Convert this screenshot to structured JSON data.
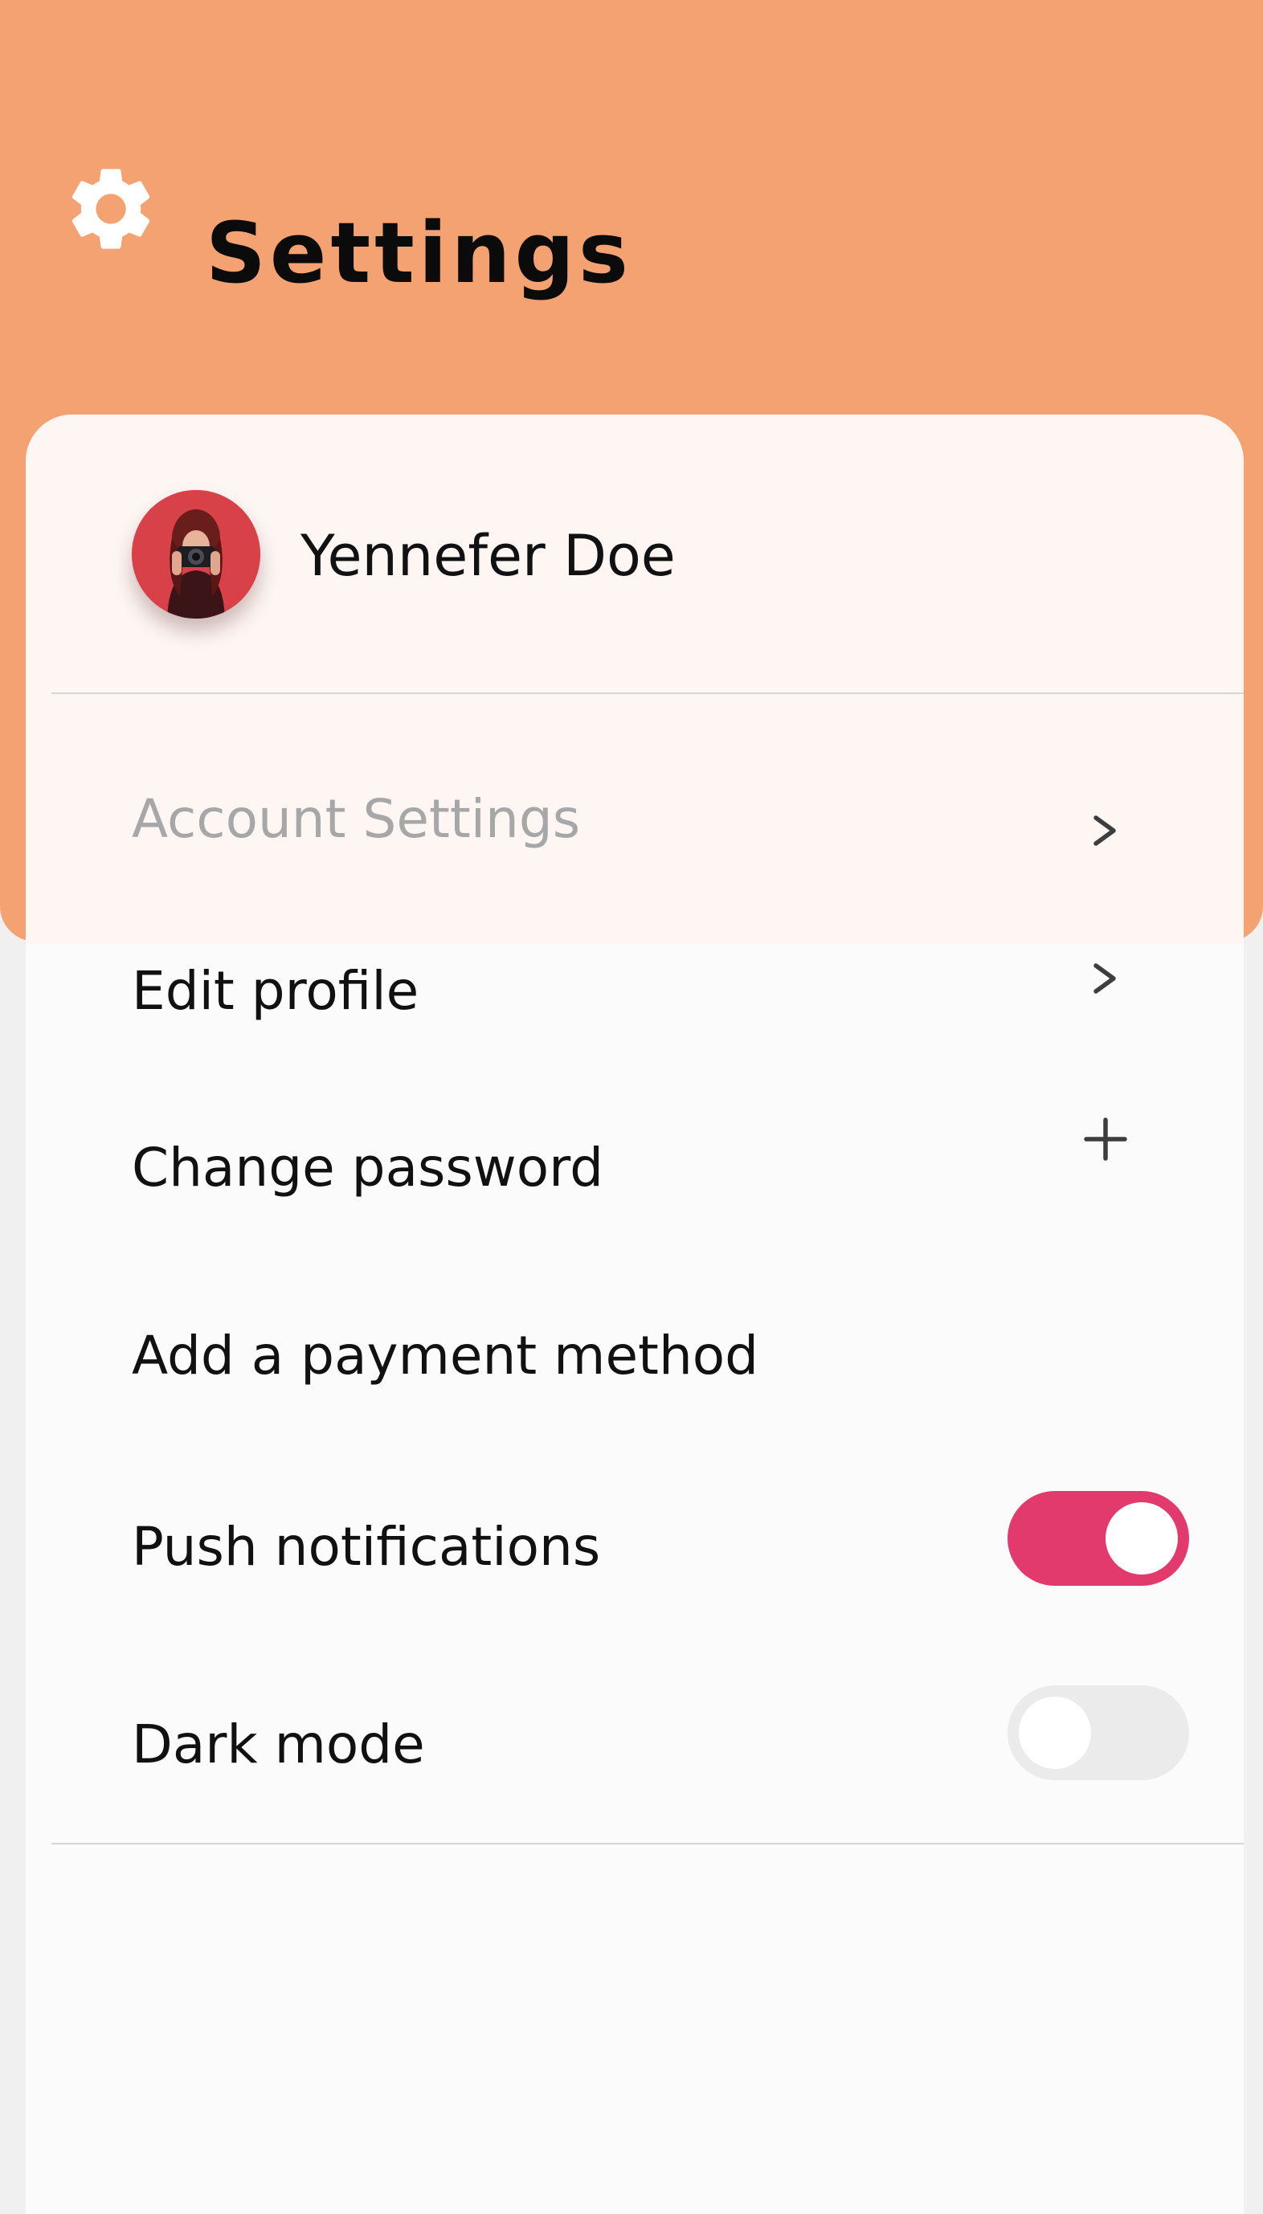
{
  "header": {
    "title": "Settings",
    "icon": "gear-icon",
    "background_color": "#f5a273"
  },
  "profile": {
    "name": "Yennefer Doe",
    "avatar": "avatar-photo"
  },
  "account_settings": {
    "label": "Account Settings",
    "icon": "chevron-right-icon"
  },
  "items": [
    {
      "label": "Edit profile",
      "icon": "chevron-right-icon"
    },
    {
      "label": "Change password",
      "icon": "plus-icon"
    },
    {
      "label": "Add a payment method"
    },
    {
      "label": "Push notifications",
      "toggle_on": true
    },
    {
      "label": "Dark mode",
      "toggle_on": false
    }
  ],
  "colors": {
    "accent": "#e33a6d",
    "header": "#f5a273",
    "card": "#fbfbfb",
    "muted_text": "#a7a7a7"
  }
}
